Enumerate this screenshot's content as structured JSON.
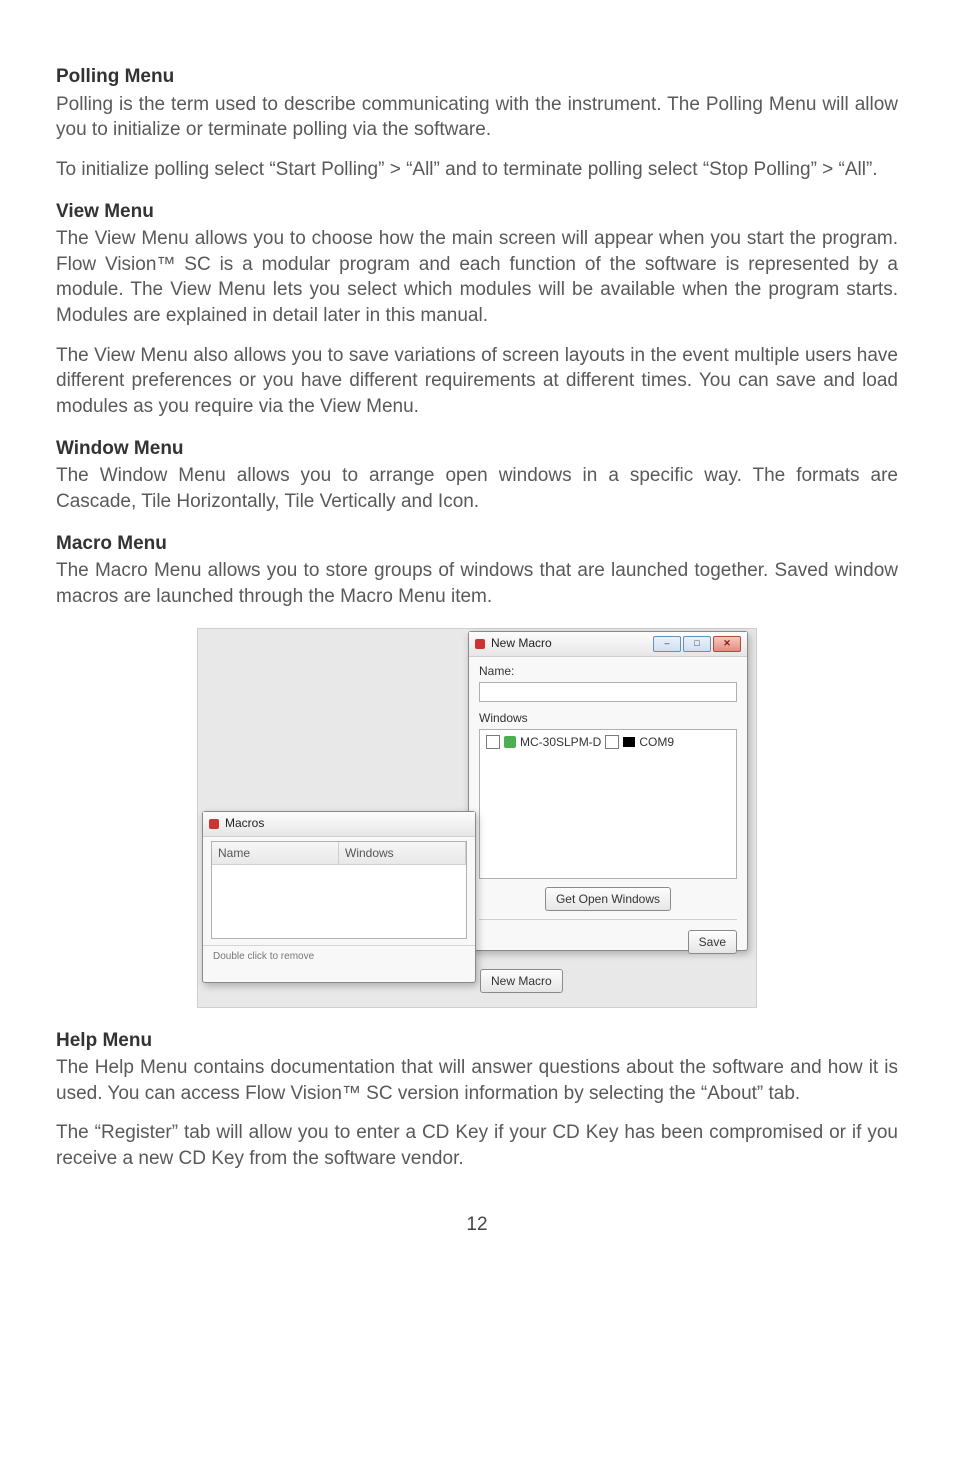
{
  "sections": {
    "polling": {
      "heading": "Polling Menu",
      "p1": "Polling is the term used to describe communicating with the instrument. The Polling Menu will allow you to initialize or terminate polling via the software.",
      "p2": "To initialize polling select “Start Polling” > “All” and to terminate polling select “Stop Polling” > “All”."
    },
    "view": {
      "heading": "View Menu",
      "p1": "The View Menu allows you to choose how the main screen will appear when you start the program. Flow Vision™ SC is a modular program and each function of the software is represented by a module. The View Menu lets you select which modules will be available when the program starts. Modules are explained in detail later in this manual.",
      "p2": "The View Menu also allows you to save variations of screen layouts in the event multiple users have different preferences or you have different requirements at different times. You can save and load modules as you require via the View Menu."
    },
    "window": {
      "heading": "Window Menu",
      "p1": "The Window Menu allows you to arrange open windows in a specific way. The formats are Cascade, Tile Horizontally, Tile Vertically and Icon."
    },
    "macro": {
      "heading": "Macro Menu",
      "p1": "The Macro Menu allows you to store groups of windows that are launched together. Saved window macros are launched through the Macro Menu item."
    },
    "help": {
      "heading": "Help Menu",
      "p1": "The Help Menu contains documentation that will answer questions about the software and how it is used. You can access Flow Vision™ SC version information by selecting the “About” tab.",
      "p2": "The “Register” tab will allow you to enter a CD Key if your CD Key has been compromised or if you receive a new CD Key from the software vendor."
    }
  },
  "screenshot": {
    "macrosWindow": {
      "title": "Macros",
      "col1": "Name",
      "col2": "Windows",
      "hint": "Double click to remove",
      "newMacroBtn": "New Macro"
    },
    "newMacroWindow": {
      "title": "New Macro",
      "nameLabel": "Name:",
      "windowsLabel": "Windows",
      "listItem1a": "MC-30SLPM-D",
      "listItem1b": "COM9",
      "getOpenBtn": "Get Open Windows",
      "saveBtn": "Save",
      "winMin": "–",
      "winMax": "□",
      "winClose": "✕"
    }
  },
  "pageNumber": "12"
}
